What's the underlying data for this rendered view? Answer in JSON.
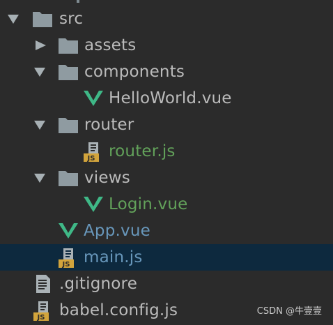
{
  "tree": {
    "items": [
      {
        "label": "src",
        "color": "#bbbbbb",
        "icon": "folder-icon",
        "expanded": true
      },
      {
        "label": "assets",
        "color": "#bbbbbb",
        "icon": "folder-icon",
        "expanded": false
      },
      {
        "label": "components",
        "color": "#bbbbbb",
        "icon": "folder-icon",
        "expanded": true
      },
      {
        "label": "HelloWorld.vue",
        "color": "#bbbbbb",
        "icon": "vue-file-icon"
      },
      {
        "label": "router",
        "color": "#bbbbbb",
        "icon": "folder-icon",
        "expanded": true
      },
      {
        "label": "router.js",
        "color": "#62a15a",
        "icon": "js-file-icon"
      },
      {
        "label": "views",
        "color": "#bbbbbb",
        "icon": "folder-icon",
        "expanded": true
      },
      {
        "label": "Login.vue",
        "color": "#62a15a",
        "icon": "vue-file-icon"
      },
      {
        "label": "App.vue",
        "color": "#6897bb",
        "icon": "vue-file-icon"
      },
      {
        "label": "main.js",
        "color": "#6897bb",
        "icon": "js-file-icon",
        "selected": true
      },
      {
        "label": ".gitignore",
        "color": "#bbbbbb",
        "icon": "text-file-icon"
      },
      {
        "label": "babel.config.js",
        "color": "#bbbbbb",
        "icon": "js-file-icon"
      }
    ]
  },
  "js_badge": "JS",
  "watermark": "CSDN @牛壹壹",
  "colors": {
    "background": "#2b2b2b",
    "selection": "#0d293e",
    "folder": "#8f9ba1",
    "vue": "#3fb887",
    "js_badge": "#d2a43c"
  }
}
